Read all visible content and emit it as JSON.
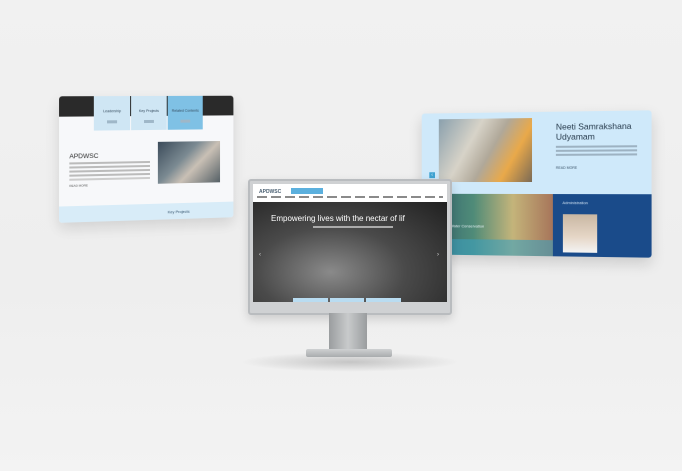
{
  "left_panel": {
    "tabs": [
      "Leadership",
      "Key Projects",
      "Related Contents"
    ],
    "title": "APDWSC",
    "read_more": "READ MORE",
    "band_label": "Key Projects"
  },
  "right_panel": {
    "title": "Neeti Samrakshana Udyamam",
    "read_more": "READ MORE",
    "tile_left": "Water Conservation",
    "tile_right": "Administration"
  },
  "monitor": {
    "logo": "APDWSC",
    "hero_title": "Empowering lives with the nectar of lif"
  },
  "colors": {
    "accent_blue": "#5bb0de",
    "light_blue": "#cfe9fa",
    "dark_blue": "#1a4b8a"
  }
}
